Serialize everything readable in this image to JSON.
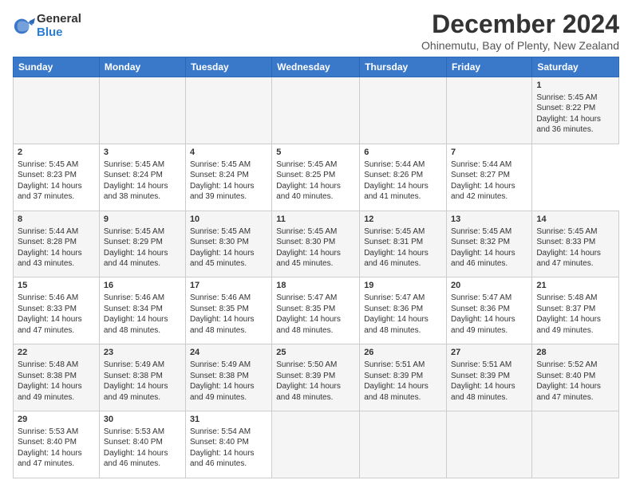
{
  "logo": {
    "general": "General",
    "blue": "Blue"
  },
  "header": {
    "title": "December 2024",
    "subtitle": "Ohinemutu, Bay of Plenty, New Zealand"
  },
  "calendar": {
    "headers": [
      "Sunday",
      "Monday",
      "Tuesday",
      "Wednesday",
      "Thursday",
      "Friday",
      "Saturday"
    ],
    "weeks": [
      [
        {
          "day": "",
          "text": ""
        },
        {
          "day": "",
          "text": ""
        },
        {
          "day": "",
          "text": ""
        },
        {
          "day": "",
          "text": ""
        },
        {
          "day": "",
          "text": ""
        },
        {
          "day": "",
          "text": ""
        },
        {
          "day": "1",
          "text": "Sunrise: 5:45 AM\nSunset: 8:22 PM\nDaylight: 14 hours\nand 36 minutes."
        }
      ],
      [
        {
          "day": "2",
          "text": "Sunrise: 5:45 AM\nSunset: 8:23 PM\nDaylight: 14 hours\nand 37 minutes."
        },
        {
          "day": "3",
          "text": "Sunrise: 5:45 AM\nSunset: 8:24 PM\nDaylight: 14 hours\nand 38 minutes."
        },
        {
          "day": "4",
          "text": "Sunrise: 5:45 AM\nSunset: 8:24 PM\nDaylight: 14 hours\nand 39 minutes."
        },
        {
          "day": "5",
          "text": "Sunrise: 5:45 AM\nSunset: 8:25 PM\nDaylight: 14 hours\nand 40 minutes."
        },
        {
          "day": "6",
          "text": "Sunrise: 5:44 AM\nSunset: 8:26 PM\nDaylight: 14 hours\nand 41 minutes."
        },
        {
          "day": "7",
          "text": "Sunrise: 5:44 AM\nSunset: 8:27 PM\nDaylight: 14 hours\nand 42 minutes."
        }
      ],
      [
        {
          "day": "8",
          "text": "Sunrise: 5:44 AM\nSunset: 8:28 PM\nDaylight: 14 hours\nand 43 minutes."
        },
        {
          "day": "9",
          "text": "Sunrise: 5:45 AM\nSunset: 8:29 PM\nDaylight: 14 hours\nand 44 minutes."
        },
        {
          "day": "10",
          "text": "Sunrise: 5:45 AM\nSunset: 8:30 PM\nDaylight: 14 hours\nand 45 minutes."
        },
        {
          "day": "11",
          "text": "Sunrise: 5:45 AM\nSunset: 8:30 PM\nDaylight: 14 hours\nand 45 minutes."
        },
        {
          "day": "12",
          "text": "Sunrise: 5:45 AM\nSunset: 8:31 PM\nDaylight: 14 hours\nand 46 minutes."
        },
        {
          "day": "13",
          "text": "Sunrise: 5:45 AM\nSunset: 8:32 PM\nDaylight: 14 hours\nand 46 minutes."
        },
        {
          "day": "14",
          "text": "Sunrise: 5:45 AM\nSunset: 8:33 PM\nDaylight: 14 hours\nand 47 minutes."
        }
      ],
      [
        {
          "day": "15",
          "text": "Sunrise: 5:46 AM\nSunset: 8:33 PM\nDaylight: 14 hours\nand 47 minutes."
        },
        {
          "day": "16",
          "text": "Sunrise: 5:46 AM\nSunset: 8:34 PM\nDaylight: 14 hours\nand 48 minutes."
        },
        {
          "day": "17",
          "text": "Sunrise: 5:46 AM\nSunset: 8:35 PM\nDaylight: 14 hours\nand 48 minutes."
        },
        {
          "day": "18",
          "text": "Sunrise: 5:47 AM\nSunset: 8:35 PM\nDaylight: 14 hours\nand 48 minutes."
        },
        {
          "day": "19",
          "text": "Sunrise: 5:47 AM\nSunset: 8:36 PM\nDaylight: 14 hours\nand 48 minutes."
        },
        {
          "day": "20",
          "text": "Sunrise: 5:47 AM\nSunset: 8:36 PM\nDaylight: 14 hours\nand 49 minutes."
        },
        {
          "day": "21",
          "text": "Sunrise: 5:48 AM\nSunset: 8:37 PM\nDaylight: 14 hours\nand 49 minutes."
        }
      ],
      [
        {
          "day": "22",
          "text": "Sunrise: 5:48 AM\nSunset: 8:38 PM\nDaylight: 14 hours\nand 49 minutes."
        },
        {
          "day": "23",
          "text": "Sunrise: 5:49 AM\nSunset: 8:38 PM\nDaylight: 14 hours\nand 49 minutes."
        },
        {
          "day": "24",
          "text": "Sunrise: 5:49 AM\nSunset: 8:38 PM\nDaylight: 14 hours\nand 49 minutes."
        },
        {
          "day": "25",
          "text": "Sunrise: 5:50 AM\nSunset: 8:39 PM\nDaylight: 14 hours\nand 48 minutes."
        },
        {
          "day": "26",
          "text": "Sunrise: 5:51 AM\nSunset: 8:39 PM\nDaylight: 14 hours\nand 48 minutes."
        },
        {
          "day": "27",
          "text": "Sunrise: 5:51 AM\nSunset: 8:39 PM\nDaylight: 14 hours\nand 48 minutes."
        },
        {
          "day": "28",
          "text": "Sunrise: 5:52 AM\nSunset: 8:40 PM\nDaylight: 14 hours\nand 47 minutes."
        }
      ],
      [
        {
          "day": "29",
          "text": "Sunrise: 5:53 AM\nSunset: 8:40 PM\nDaylight: 14 hours\nand 47 minutes."
        },
        {
          "day": "30",
          "text": "Sunrise: 5:53 AM\nSunset: 8:40 PM\nDaylight: 14 hours\nand 46 minutes."
        },
        {
          "day": "31",
          "text": "Sunrise: 5:54 AM\nSunset: 8:40 PM\nDaylight: 14 hours\nand 46 minutes."
        },
        {
          "day": "",
          "text": ""
        },
        {
          "day": "",
          "text": ""
        },
        {
          "day": "",
          "text": ""
        },
        {
          "day": "",
          "text": ""
        }
      ]
    ]
  }
}
